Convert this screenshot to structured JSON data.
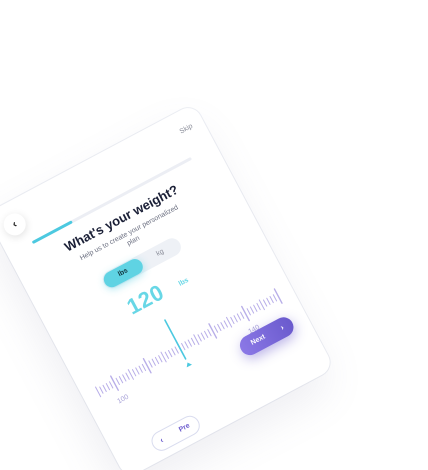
{
  "header": {
    "back_icon": "chevron-left-icon",
    "back_glyph": "‹",
    "skip_label": "Skip"
  },
  "progress": {
    "fraction": 0.25
  },
  "question": {
    "title": "What's your weight?",
    "subtitle": "Help us to create your personalized plan"
  },
  "unit_toggle": {
    "options": [
      "lbs",
      "kg"
    ],
    "selected": "lbs"
  },
  "weight": {
    "value": "120",
    "unit": "lbs"
  },
  "ruler": {
    "labels": [
      "100",
      "120",
      "140"
    ],
    "min": 95,
    "max": 150,
    "selected": 120
  },
  "nav": {
    "next_label": "Next",
    "next_glyph": "›",
    "prev_label": "Pre",
    "prev_glyph": "‹"
  },
  "colors": {
    "accent": "#4cc9e0",
    "ruler_tick": "#b8aee8",
    "primary": "#6a5acd"
  }
}
